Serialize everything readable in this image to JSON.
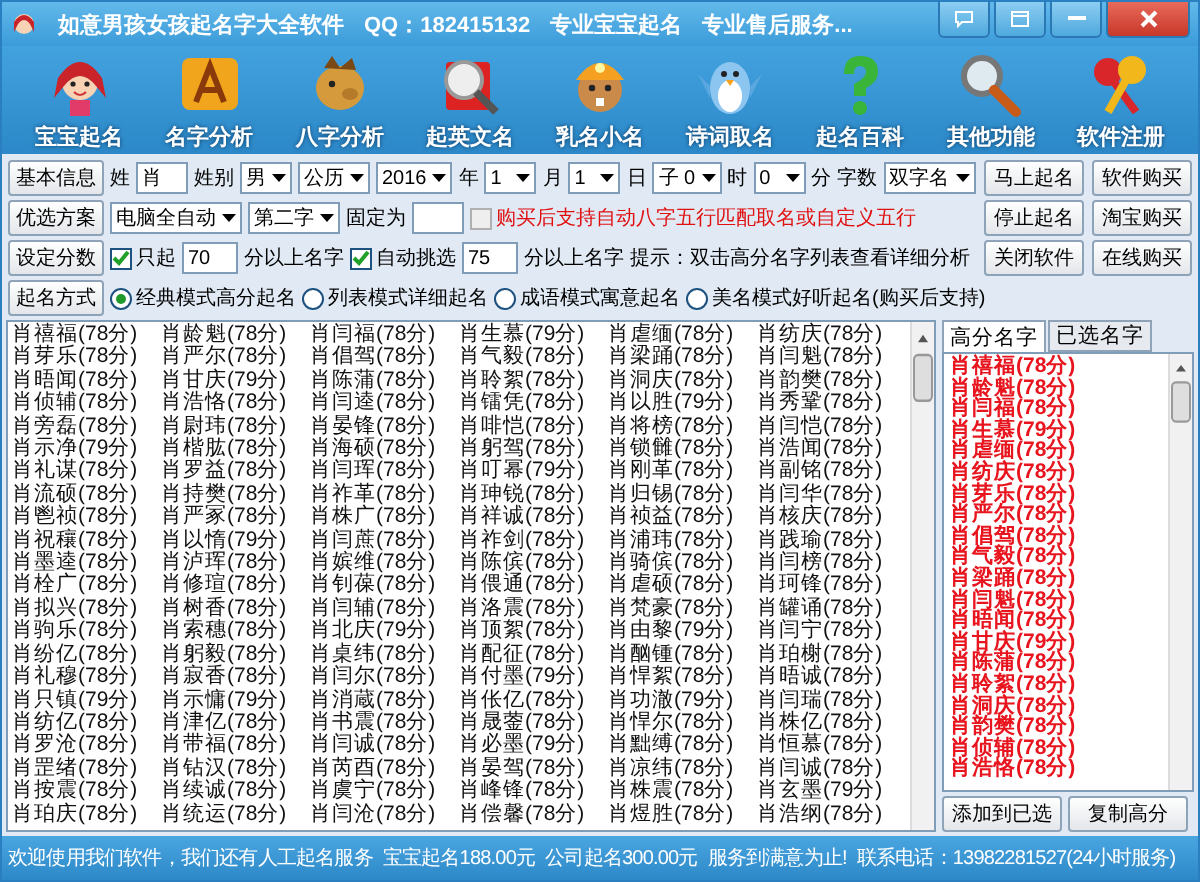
{
  "window": {
    "title": "如意男孩女孩起名字大全软件",
    "qq": "QQ：182415132",
    "slogans": [
      "专业宝宝起名",
      "专业售后服务..."
    ]
  },
  "toolbar": [
    {
      "label": "宝宝起名"
    },
    {
      "label": "名字分析"
    },
    {
      "label": "八字分析"
    },
    {
      "label": "起英文名"
    },
    {
      "label": "乳名小名"
    },
    {
      "label": "诗词取名"
    },
    {
      "label": "起名百科"
    },
    {
      "label": "其他功能"
    },
    {
      "label": "软件注册"
    }
  ],
  "form": {
    "rows": [
      {
        "items": [
          {
            "kind": "button",
            "label": "基本信息"
          },
          {
            "kind": "label",
            "text": "姓"
          },
          {
            "kind": "field",
            "value": "肖"
          },
          {
            "kind": "label",
            "text": "姓别"
          },
          {
            "kind": "select",
            "value": "男"
          },
          {
            "kind": "select",
            "value": "公历"
          },
          {
            "kind": "select",
            "value": "2016"
          },
          {
            "kind": "label",
            "text": "年"
          },
          {
            "kind": "select",
            "value": "1"
          },
          {
            "kind": "label",
            "text": "月"
          },
          {
            "kind": "select",
            "value": "1"
          },
          {
            "kind": "label",
            "text": "日"
          },
          {
            "kind": "select",
            "value": "子 0"
          },
          {
            "kind": "label",
            "text": "时"
          },
          {
            "kind": "select",
            "value": "0"
          },
          {
            "kind": "label",
            "text": "分"
          },
          {
            "kind": "label",
            "text": "字数"
          },
          {
            "kind": "select",
            "value": "双字名"
          }
        ]
      },
      {
        "items": [
          {
            "kind": "button",
            "label": "优选方案"
          },
          {
            "kind": "select",
            "value": "电脑全自动"
          },
          {
            "kind": "select",
            "value": "第二字"
          },
          {
            "kind": "label",
            "text": "固定为"
          },
          {
            "kind": "field"
          },
          {
            "kind": "checkbox",
            "label": "购买后支持自动八字五行匹配取名或自定义五行",
            "checked": false,
            "disabled": true,
            "emphasis": true
          }
        ]
      },
      {
        "items": [
          {
            "kind": "button",
            "label": "设定分数"
          },
          {
            "kind": "checkbox",
            "label": "只起",
            "checked": true,
            "disabled": false,
            "emphasis": false
          },
          {
            "kind": "field",
            "value": "70"
          },
          {
            "kind": "label",
            "text": "分以上名字"
          },
          {
            "kind": "checkbox",
            "label": "自动挑选",
            "checked": true,
            "disabled": false,
            "emphasis": false
          },
          {
            "kind": "field",
            "value": "75"
          },
          {
            "kind": "label",
            "text": "分以上名字"
          },
          {
            "kind": "label",
            "text": "提示：双击高分名字列表查看详细分析"
          }
        ]
      },
      {
        "items": [
          {
            "kind": "button",
            "label": "起名方式"
          },
          {
            "kind": "radio",
            "label": "经典模式高分起名",
            "selected": true
          },
          {
            "kind": "radio",
            "label": "列表模式详细起名",
            "selected": false
          },
          {
            "kind": "radio",
            "label": "成语模式寓意起名",
            "selected": false
          },
          {
            "kind": "radio",
            "label": "美名模式好听起名(购买后支持)",
            "selected": false
          }
        ]
      }
    ],
    "actions": [
      "马上起名",
      "软件购买",
      "停止起名",
      "淘宝购买",
      "关闭软件",
      "在线购买"
    ]
  },
  "name_grid": {
    "rows": [
      [
        "肖禧福(78分)",
        "肖龄魁(78分)",
        "肖闫福(78分)",
        "肖生慕(79分)",
        "肖虐缅(78分)",
        "肖纺庆(78分)"
      ],
      [
        "肖芽乐(78分)",
        "肖严尔(78分)",
        "肖倡驾(78分)",
        "肖气毅(78分)",
        "肖梁踊(78分)",
        "肖闫魁(78分)"
      ],
      [
        "肖晤闻(78分)",
        "肖甘庆(79分)",
        "肖陈蒲(78分)",
        "肖聆絮(78分)",
        "肖洞庆(78分)",
        "肖韵樊(78分)"
      ],
      [
        "肖侦辅(78分)",
        "肖浩恪(78分)",
        "肖闫逵(78分)",
        "肖镭凭(78分)",
        "肖以胜(79分)",
        "肖秀鞏(78分)"
      ],
      [
        "肖旁磊(78分)",
        "肖尉玮(78分)",
        "肖晏锋(78分)",
        "肖啡恺(78分)",
        "肖将榜(78分)",
        "肖闫恺(78分)"
      ],
      [
        "肖示净(79分)",
        "肖楷肱(78分)",
        "肖海硕(78分)",
        "肖躬驾(78分)",
        "肖锁雠(78分)",
        "肖浩闻(78分)"
      ],
      [
        "肖礼谋(78分)",
        "肖罗益(78分)",
        "肖闫珲(78分)",
        "肖叮幂(79分)",
        "肖刚革(78分)",
        "肖副铭(78分)"
      ],
      [
        "肖流硕(78分)",
        "肖持樊(78分)",
        "肖祚革(78分)",
        "肖珅锐(78分)",
        "肖归锡(78分)",
        "肖闫华(78分)"
      ],
      [
        "肖鬯祯(78分)",
        "肖严冢(78分)",
        "肖株广(78分)",
        "肖祥诚(78分)",
        "肖祯益(78分)",
        "肖核庆(78分)"
      ],
      [
        "肖祝穰(78分)",
        "肖以惰(79分)",
        "肖闫蔗(78分)",
        "肖祚剑(78分)",
        "肖浦玮(78分)",
        "肖践瑜(78分)"
      ],
      [
        "肖墨逵(78分)",
        "肖泸珲(78分)",
        "肖嫔维(78分)",
        "肖陈傧(78分)",
        "肖骑傧(78分)",
        "肖闫榜(78分)"
      ],
      [
        "肖栓广(78分)",
        "肖修瑄(78分)",
        "肖钊葆(78分)",
        "肖偎通(78分)",
        "肖虐硕(78分)",
        "肖珂锋(78分)"
      ],
      [
        "肖拟兴(78分)",
        "肖树香(78分)",
        "肖闫辅(78分)",
        "肖洛震(78分)",
        "肖梵豪(78分)",
        "肖罐诵(78分)"
      ],
      [
        "肖驹乐(78分)",
        "肖索穗(78分)",
        "肖北庆(79分)",
        "肖顶絮(78分)",
        "肖由黎(79分)",
        "肖闫宁(78分)"
      ],
      [
        "肖纷亿(78分)",
        "肖躬毅(78分)",
        "肖桌纬(78分)",
        "肖配征(78分)",
        "肖酗锺(78分)",
        "肖珀榭(78分)"
      ],
      [
        "肖礼穆(78分)",
        "肖寂香(78分)",
        "肖闫尔(78分)",
        "肖付墨(79分)",
        "肖悍絮(78分)",
        "肖晤诚(78分)"
      ],
      [
        "肖只镇(79分)",
        "肖示慵(79分)",
        "肖消蔵(78分)",
        "肖伥亿(78分)",
        "肖功澈(79分)",
        "肖闫瑞(78分)"
      ],
      [
        "肖纺亿(78分)",
        "肖津亿(78分)",
        "肖书震(78分)",
        "肖晟蓥(78分)",
        "肖悍尔(78分)",
        "肖株亿(78分)"
      ],
      [
        "肖罗沧(78分)",
        "肖带福(78分)",
        "肖闫诚(78分)",
        "肖必墨(79分)",
        "肖黜缚(78分)",
        "肖恒慕(78分)"
      ],
      [
        "肖罡绪(78分)",
        "肖钻汉(78分)",
        "肖芮酉(78分)",
        "肖晏驾(78分)",
        "肖凉纬(78分)",
        "肖闫诚(78分)"
      ],
      [
        "肖按震(78分)",
        "肖续诚(78分)",
        "肖虞宁(78分)",
        "肖峰锋(78分)",
        "肖株震(78分)",
        "肖玄墨(79分)"
      ],
      [
        "肖珀庆(78分)",
        "肖统运(78分)",
        "肖闫沧(78分)",
        "肖偿馨(78分)",
        "肖煜胜(78分)",
        "肖浩纲(78分)"
      ]
    ]
  },
  "side_panel": {
    "tabs": [
      {
        "label": "高分名字",
        "selected": true
      },
      {
        "label": "已选名字",
        "selected": false
      }
    ],
    "high_score_names": [
      "肖禧福(78分)",
      "肖龄魁(78分)",
      "肖闫福(78分)",
      "肖生慕(79分)",
      "肖虐缅(78分)",
      "肖纺庆(78分)",
      "肖芽乐(78分)",
      "肖严尔(78分)",
      "肖倡驾(78分)",
      "肖气毅(78分)",
      "肖梁踊(78分)",
      "肖闫魁(78分)",
      "肖晤闻(78分)",
      "肖甘庆(79分)",
      "肖陈蒲(78分)",
      "肖聆絮(78分)",
      "肖洞庆(78分)",
      "肖韵樊(78分)",
      "肖侦辅(78分)",
      "肖浩恪(78分)"
    ],
    "buttons": [
      "添加到已选",
      "复制高分"
    ]
  },
  "status_bar": [
    "欢迎使用我们软件，我们还有人工起名服务",
    "宝宝起名188.00元",
    "公司起名300.00元",
    "服务到满意为止!",
    "联系电话：13982281527(24小时服务)"
  ]
}
